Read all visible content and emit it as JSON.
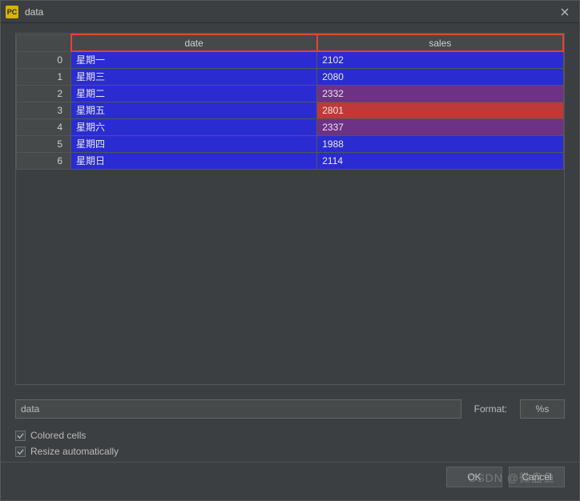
{
  "window": {
    "icon_label": "PC",
    "title": "data"
  },
  "table": {
    "columns": [
      "date",
      "sales"
    ],
    "rows": [
      {
        "idx": 0,
        "date": "星期一",
        "sales": 2102,
        "date_bg": "#2a2cd2",
        "sales_bg": "#2a2cd2"
      },
      {
        "idx": 1,
        "date": "星期三",
        "sales": 2080,
        "date_bg": "#2a2cd2",
        "sales_bg": "#2a2cd2"
      },
      {
        "idx": 2,
        "date": "星期二",
        "sales": 2332,
        "date_bg": "#2a2cd2",
        "sales_bg": "#6d3285"
      },
      {
        "idx": 3,
        "date": "星期五",
        "sales": 2801,
        "date_bg": "#2a2cd2",
        "sales_bg": "#c13838"
      },
      {
        "idx": 4,
        "date": "星期六",
        "sales": 2337,
        "date_bg": "#2a2cd2",
        "sales_bg": "#6d3285"
      },
      {
        "idx": 5,
        "date": "星期四",
        "sales": 1988,
        "date_bg": "#2a2cd2",
        "sales_bg": "#2a2cd2"
      },
      {
        "idx": 6,
        "date": "星期日",
        "sales": 2114,
        "date_bg": "#2a2cd2",
        "sales_bg": "#2a2cd2"
      }
    ]
  },
  "controls": {
    "expression_value": "data",
    "format_label": "Format:",
    "format_value": "%s",
    "colored_cells_label": "Colored cells",
    "colored_cells_checked": true,
    "resize_auto_label": "Resize automatically",
    "resize_auto_checked": true
  },
  "footer": {
    "ok_label": "OK",
    "cancel_label": "Cancel"
  },
  "watermark": "CSDN @微盘鱼"
}
